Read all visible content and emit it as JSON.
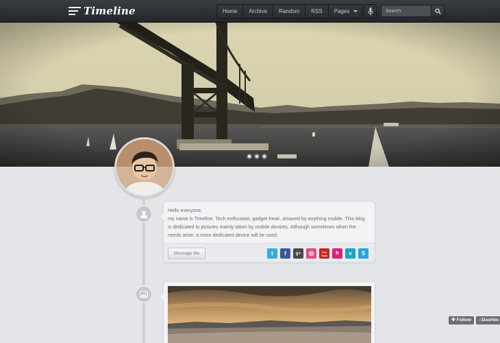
{
  "header": {
    "logo_text": "Timeline",
    "nav": [
      {
        "label": "Home"
      },
      {
        "label": "Archive"
      },
      {
        "label": "Random"
      },
      {
        "label": "RSS"
      },
      {
        "label": "Pages"
      }
    ],
    "search_placeholder": "Search"
  },
  "hero": {
    "slides_count": 3,
    "active_slide": 1
  },
  "about": {
    "text_lines": [
      "Hello everyone,",
      "my name is Timeline. Tech enthusiast, gadget freak, amazed by anything mobile. This blog",
      "is dedicated to pictures mainly taken by mobile devices. Although sometimes when the",
      "needs arise, a more dedicated device will be used."
    ],
    "message_button": "Message Me",
    "social": [
      {
        "name": "twitter-icon",
        "glyph": "t",
        "color": "#3aa9dd"
      },
      {
        "name": "facebook-icon",
        "glyph": "f",
        "color": "#3b5998"
      },
      {
        "name": "google-plus-icon",
        "glyph": "g+",
        "color": "#444444"
      },
      {
        "name": "dribbble-icon",
        "glyph": "◎",
        "color": "#e04a87"
      },
      {
        "name": "youtube-icon",
        "glyph": "You​Tube",
        "color": "#cc2222"
      },
      {
        "name": "flickr-icon",
        "glyph": "fr",
        "color": "#d7237b"
      },
      {
        "name": "vimeo-icon",
        "glyph": "v",
        "color": "#19a4c9"
      },
      {
        "name": "skype-icon",
        "glyph": "S",
        "color": "#2aa5dc"
      }
    ]
  },
  "footer_buttons": {
    "follow": "Follow",
    "dashboard": "Dashbo"
  }
}
